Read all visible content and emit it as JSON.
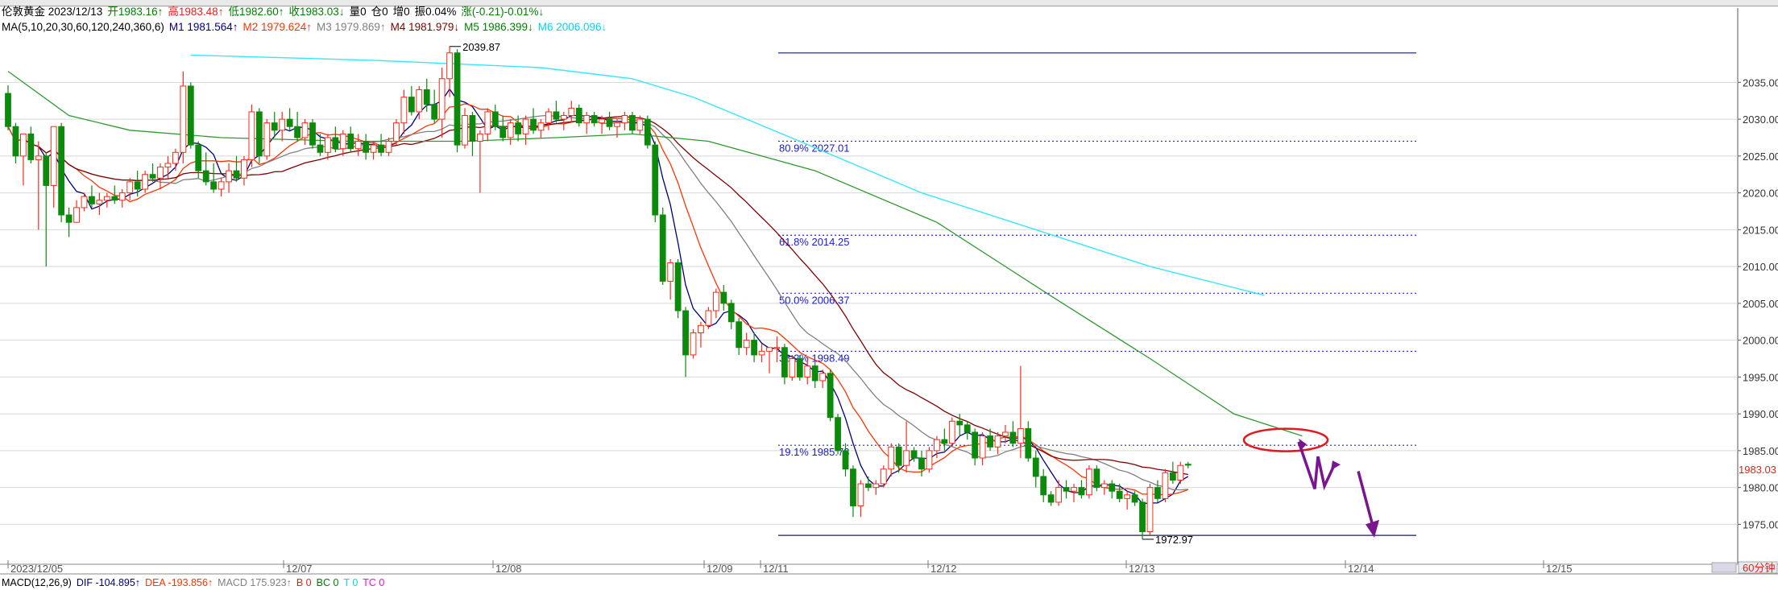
{
  "header": {
    "line1": [
      {
        "text": "伦敦黄金 2023/12/13",
        "color": "#000000"
      },
      {
        "text": "开1983.16↑",
        "color": "#008000"
      },
      {
        "text": "高1983.48↑",
        "color": "#e0241b"
      },
      {
        "text": "低1982.60↑",
        "color": "#008000"
      },
      {
        "text": "收1983.03↓",
        "color": "#008000"
      },
      {
        "text": "量0",
        "color": "#000000"
      },
      {
        "text": "仓0",
        "color": "#000000"
      },
      {
        "text": "增0",
        "color": "#000000"
      },
      {
        "text": "振0.04%",
        "color": "#000000"
      },
      {
        "text": "涨(-0.21)-0.01%↓",
        "color": "#008000"
      }
    ],
    "line2": [
      {
        "text": "MA(5,10,20,30,60,120,240,360,6)",
        "color": "#000000"
      },
      {
        "text": "M1 1981.564↑",
        "color": "#00007f"
      },
      {
        "text": "M2 1979.624↑",
        "color": "#ff3300"
      },
      {
        "text": "M3 1979.869↑",
        "color": "#808080"
      },
      {
        "text": "M4 1981.979↓",
        "color": "#7f0000"
      },
      {
        "text": "M5 1986.399↓",
        "color": "#008000"
      },
      {
        "text": "M6 2006.096↓",
        "color": "#00d8f0"
      }
    ]
  },
  "macd_header": [
    {
      "text": "MACD(12,26,9)",
      "color": "#000000"
    },
    {
      "text": "DIF -104.895↑",
      "color": "#00007f"
    },
    {
      "text": "DEA -193.856↑",
      "color": "#ff3300"
    },
    {
      "text": "MACD 175.923↑",
      "color": "#808080"
    },
    {
      "text": "B 0",
      "color": "#e0241b"
    },
    {
      "text": "BC 0",
      "color": "#008000"
    },
    {
      "text": "T 0",
      "color": "#00d8f0"
    },
    {
      "text": "TC 0",
      "color": "#ff00ff"
    }
  ],
  "chart_data": {
    "type": "candlestick",
    "instrument": "伦敦黄金",
    "timeframe_label": "60分钟",
    "last_price_label": "1983.03",
    "y_ticks": [
      "2035.00",
      "2030.00",
      "2025.00",
      "2020.00",
      "2015.00",
      "2010.00",
      "2005.00",
      "2000.00",
      "1995.00",
      "1990.00",
      "1985.00",
      "1980.00",
      "1975.00"
    ],
    "x_ticks": [
      "2023/12/05",
      "12/07",
      "12/08",
      "12/09",
      "12/11",
      "12/12",
      "12/13",
      "12/14",
      "12/15"
    ],
    "ylim": [
      1971.0,
      2040.5
    ],
    "grid": true,
    "candles": [
      [
        2033.5,
        2034.6,
        2028.5,
        2029.0
      ],
      [
        2029.0,
        2029.5,
        2024.0,
        2025.0
      ],
      [
        2025.0,
        2028.0,
        2021.0,
        2028.0
      ],
      [
        2028.0,
        2029.0,
        2024.0,
        2024.5
      ],
      [
        2024.5,
        2027.0,
        2015.0,
        2025.0
      ],
      [
        2025.0,
        2025.5,
        2010.0,
        2021.0
      ],
      [
        2021.0,
        2029.0,
        2018.0,
        2029.0
      ],
      [
        2029.0,
        2029.5,
        2016.0,
        2017.0
      ],
      [
        2017.0,
        2018.0,
        2014.0,
        2016.0
      ],
      [
        2016.0,
        2019.0,
        2016.0,
        2018.0
      ],
      [
        2018.0,
        2020.0,
        2017.5,
        2019.5
      ],
      [
        2019.5,
        2021.0,
        2018.0,
        2018.5
      ],
      [
        2018.5,
        2020.0,
        2017.0,
        2019.0
      ],
      [
        2019.0,
        2020.0,
        2018.0,
        2019.5
      ],
      [
        2019.5,
        2021.0,
        2018.5,
        2019.0
      ],
      [
        2019.0,
        2020.5,
        2018.0,
        2020.0
      ],
      [
        2020.0,
        2022.0,
        2019.0,
        2021.5
      ],
      [
        2021.5,
        2023.0,
        2019.5,
        2020.5
      ],
      [
        2020.5,
        2023.0,
        2020.0,
        2022.5
      ],
      [
        2022.5,
        2024.0,
        2021.5,
        2022.0
      ],
      [
        2022.0,
        2024.0,
        2020.5,
        2023.5
      ],
      [
        2023.5,
        2025.0,
        2022.0,
        2024.0
      ],
      [
        2024.0,
        2026.0,
        2023.0,
        2025.5
      ],
      [
        2025.5,
        2036.5,
        2024.0,
        2034.5
      ],
      [
        2034.5,
        2035.0,
        2026.0,
        2026.5
      ],
      [
        2026.5,
        2027.0,
        2022.0,
        2023.0
      ],
      [
        2023.0,
        2025.5,
        2021.0,
        2021.5
      ],
      [
        2021.5,
        2024.0,
        2020.0,
        2020.5
      ],
      [
        2020.5,
        2022.0,
        2019.5,
        2021.5
      ],
      [
        2021.5,
        2024.0,
        2020.0,
        2023.0
      ],
      [
        2023.0,
        2025.0,
        2021.5,
        2022.0
      ],
      [
        2022.0,
        2025.0,
        2021.0,
        2024.5
      ],
      [
        2024.5,
        2032.0,
        2023.5,
        2031.0
      ],
      [
        2031.0,
        2031.5,
        2024.0,
        2025.0
      ],
      [
        2025.0,
        2030.0,
        2024.5,
        2029.5
      ],
      [
        2029.5,
        2031.0,
        2027.5,
        2028.5
      ],
      [
        2028.5,
        2031.0,
        2027.0,
        2030.0
      ],
      [
        2030.0,
        2031.5,
        2028.5,
        2029.0
      ],
      [
        2029.0,
        2031.0,
        2027.0,
        2027.5
      ],
      [
        2027.5,
        2030.0,
        2026.5,
        2029.5
      ],
      [
        2029.5,
        2030.0,
        2026.0,
        2026.5
      ],
      [
        2026.5,
        2028.0,
        2025.0,
        2025.5
      ],
      [
        2025.5,
        2028.0,
        2024.5,
        2027.5
      ],
      [
        2027.5,
        2029.0,
        2025.5,
        2026.0
      ],
      [
        2026.0,
        2028.5,
        2025.0,
        2028.0
      ],
      [
        2028.0,
        2029.0,
        2025.5,
        2026.0
      ],
      [
        2026.0,
        2028.0,
        2025.0,
        2027.0
      ],
      [
        2027.0,
        2028.0,
        2024.5,
        2025.5
      ],
      [
        2025.5,
        2027.0,
        2024.5,
        2026.5
      ],
      [
        2026.5,
        2028.0,
        2025.0,
        2025.5
      ],
      [
        2025.5,
        2027.5,
        2025.0,
        2027.0
      ],
      [
        2027.0,
        2030.0,
        2026.5,
        2029.5
      ],
      [
        2029.5,
        2034.0,
        2028.0,
        2033.0
      ],
      [
        2033.0,
        2034.5,
        2030.5,
        2031.0
      ],
      [
        2031.0,
        2034.5,
        2030.0,
        2034.0
      ],
      [
        2034.0,
        2035.5,
        2031.0,
        2032.0
      ],
      [
        2032.0,
        2034.0,
        2029.5,
        2030.0
      ],
      [
        2030.0,
        2037.0,
        2027.5,
        2035.5
      ],
      [
        2035.5,
        2039.9,
        2033.0,
        2039.0
      ],
      [
        2039.0,
        2039.5,
        2025.5,
        2026.5
      ],
      [
        2026.5,
        2031.5,
        2026.0,
        2030.5
      ],
      [
        2030.5,
        2031.0,
        2025.0,
        2027.0
      ],
      [
        2027.0,
        2028.5,
        2020.0,
        2028.0
      ],
      [
        2028.0,
        2031.5,
        2027.0,
        2031.0
      ],
      [
        2031.0,
        2032.0,
        2028.5,
        2029.0
      ],
      [
        2029.0,
        2030.5,
        2027.0,
        2027.5
      ],
      [
        2027.5,
        2030.0,
        2026.5,
        2029.5
      ],
      [
        2029.5,
        2030.5,
        2027.0,
        2028.0
      ],
      [
        2028.0,
        2030.5,
        2026.5,
        2030.0
      ],
      [
        2030.0,
        2031.5,
        2028.0,
        2028.5
      ],
      [
        2028.5,
        2030.0,
        2027.5,
        2029.5
      ],
      [
        2029.5,
        2031.5,
        2028.5,
        2031.0
      ],
      [
        2031.0,
        2032.5,
        2029.5,
        2030.0
      ],
      [
        2030.0,
        2031.0,
        2028.5,
        2030.5
      ],
      [
        2030.5,
        2032.5,
        2029.5,
        2031.5
      ],
      [
        2031.5,
        2032.0,
        2029.0,
        2029.5
      ],
      [
        2029.5,
        2031.0,
        2028.0,
        2030.5
      ],
      [
        2030.5,
        2031.0,
        2029.0,
        2029.5
      ],
      [
        2029.5,
        2030.5,
        2028.0,
        2030.0
      ],
      [
        2030.0,
        2031.0,
        2028.5,
        2029.0
      ],
      [
        2029.0,
        2030.0,
        2027.5,
        2029.5
      ],
      [
        2029.5,
        2031.0,
        2028.5,
        2030.5
      ],
      [
        2030.5,
        2031.0,
        2028.0,
        2028.5
      ],
      [
        2028.5,
        2030.5,
        2028.0,
        2030.0
      ],
      [
        2030.0,
        2030.5,
        2026.0,
        2026.5
      ],
      [
        2026.5,
        2027.0,
        2016.0,
        2017.0
      ],
      [
        2017.0,
        2018.0,
        2007.5,
        2008.0
      ],
      [
        2008.0,
        2011.0,
        2005.5,
        2010.5
      ],
      [
        2010.5,
        2011.0,
        2003.0,
        2004.0
      ],
      [
        2004.0,
        2004.5,
        1995.0,
        1998.0
      ],
      [
        1998.0,
        2001.5,
        1997.5,
        2001.0
      ],
      [
        2001.0,
        2002.5,
        1999.0,
        2002.0
      ],
      [
        2002.0,
        2004.5,
        2001.5,
        2004.0
      ],
      [
        2004.0,
        2007.0,
        2003.0,
        2006.5
      ],
      [
        2006.5,
        2007.5,
        2004.0,
        2005.0
      ],
      [
        2005.0,
        2005.5,
        2001.5,
        2002.5
      ],
      [
        2002.5,
        2003.0,
        1998.0,
        1999.0
      ],
      [
        1999.0,
        2001.0,
        1998.0,
        2000.0
      ],
      [
        2000.0,
        2001.0,
        1997.0,
        1998.0
      ],
      [
        1998.0,
        1999.5,
        1997.0,
        1998.5
      ],
      [
        1998.5,
        1999.0,
        1995.5,
        1999.0
      ],
      [
        1999.0,
        2000.5,
        1997.0,
        1999.0
      ],
      [
        1999.0,
        1999.5,
        1994.0,
        1995.0
      ],
      [
        1995.0,
        1998.0,
        1994.5,
        1997.5
      ],
      [
        1997.5,
        1998.0,
        1994.5,
        1995.0
      ],
      [
        1995.0,
        1997.5,
        1994.0,
        1996.5
      ],
      [
        1996.5,
        1997.0,
        1993.5,
        1994.5
      ],
      [
        1994.5,
        1996.0,
        1993.5,
        1995.5
      ],
      [
        1995.5,
        1996.0,
        1989.0,
        1989.5
      ],
      [
        1989.5,
        1990.0,
        1984.5,
        1985.0
      ],
      [
        1985.0,
        1986.0,
        1981.5,
        1982.5
      ],
      [
        1982.5,
        1983.0,
        1976.0,
        1977.5
      ],
      [
        1977.5,
        1981.0,
        1976.0,
        1980.5
      ],
      [
        1980.5,
        1981.5,
        1979.5,
        1980.0
      ],
      [
        1980.0,
        1981.0,
        1979.0,
        1980.5
      ],
      [
        1980.5,
        1983.0,
        1980.0,
        1982.5
      ],
      [
        1982.5,
        1986.0,
        1981.5,
        1985.5
      ],
      [
        1985.5,
        1986.0,
        1982.0,
        1983.0
      ],
      [
        1983.0,
        1989.0,
        1982.0,
        1985.0
      ],
      [
        1985.0,
        1985.5,
        1983.5,
        1984.0
      ],
      [
        1984.0,
        1985.0,
        1981.5,
        1982.5
      ],
      [
        1982.5,
        1985.5,
        1982.0,
        1985.0
      ],
      [
        1985.0,
        1987.0,
        1984.0,
        1986.5
      ],
      [
        1986.5,
        1988.0,
        1985.0,
        1986.0
      ],
      [
        1986.0,
        1989.5,
        1985.5,
        1989.0
      ],
      [
        1989.0,
        1990.0,
        1987.0,
        1988.5
      ],
      [
        1988.5,
        1989.0,
        1986.5,
        1987.5
      ],
      [
        1987.5,
        1988.0,
        1983.0,
        1984.0
      ],
      [
        1984.0,
        1987.5,
        1983.0,
        1987.0
      ],
      [
        1987.0,
        1988.0,
        1985.0,
        1985.5
      ],
      [
        1985.5,
        1987.5,
        1984.5,
        1987.0
      ],
      [
        1987.0,
        1988.5,
        1986.0,
        1987.5
      ],
      [
        1987.5,
        1989.0,
        1985.5,
        1986.0
      ],
      [
        1986.0,
        1996.5,
        1984.0,
        1988.0
      ],
      [
        1988.0,
        1989.0,
        1983.5,
        1984.0
      ],
      [
        1984.0,
        1985.0,
        1980.0,
        1981.5
      ],
      [
        1981.5,
        1982.5,
        1978.0,
        1979.0
      ],
      [
        1979.0,
        1979.5,
        1977.5,
        1978.0
      ],
      [
        1978.0,
        1981.0,
        1977.5,
        1980.0
      ],
      [
        1980.0,
        1981.0,
        1978.5,
        1979.5
      ],
      [
        1979.5,
        1980.5,
        1978.0,
        1980.0
      ],
      [
        1980.0,
        1981.0,
        1978.5,
        1979.0
      ],
      [
        1979.0,
        1983.0,
        1978.5,
        1982.5
      ],
      [
        1982.5,
        1983.0,
        1979.5,
        1980.0
      ],
      [
        1980.0,
        1981.0,
        1979.0,
        1980.5
      ],
      [
        1980.5,
        1981.0,
        1978.5,
        1979.5
      ],
      [
        1979.5,
        1980.5,
        1978.0,
        1978.5
      ],
      [
        1978.5,
        1979.5,
        1977.0,
        1979.0
      ],
      [
        1979.0,
        1979.5,
        1977.5,
        1978.0
      ],
      [
        1978.0,
        1978.5,
        1972.97,
        1974.0
      ],
      [
        1974.0,
        1980.5,
        1973.5,
        1980.0
      ],
      [
        1980.0,
        1981.0,
        1978.0,
        1978.5
      ],
      [
        1978.5,
        1982.5,
        1978.0,
        1982.0
      ],
      [
        1982.0,
        1983.5,
        1980.5,
        1981.0
      ],
      [
        1981.0,
        1983.5,
        1980.5,
        1983.0
      ],
      [
        1983.16,
        1983.48,
        1982.6,
        1983.03
      ]
    ],
    "high_label": "2039.87",
    "low_label": "1972.97",
    "fibonacci_levels": [
      {
        "label": "80.9% 2027.01",
        "price": 2027.01
      },
      {
        "label": "61.8% 2014.25",
        "price": 2014.25
      },
      {
        "label": "50.0% 2006.37",
        "price": 2006.37
      },
      {
        "label": "38.2% 1998.49",
        "price": 1998.49
      },
      {
        "label": "19.1% 1985.73",
        "price": 1985.73
      }
    ],
    "fib_top_price": 2039.0,
    "fib_bottom_price": 1973.5,
    "ma_lines": [
      {
        "name": "M1",
        "color": "#00007f",
        "period": 5
      },
      {
        "name": "M2",
        "color": "#ff3300",
        "period": 10
      },
      {
        "name": "M3",
        "color": "#808080",
        "period": 20
      },
      {
        "name": "M4",
        "color": "#7f0000",
        "period": 30
      },
      {
        "name": "M5",
        "color": "#008000",
        "period": 60
      },
      {
        "name": "M6",
        "color": "#00e5ff",
        "period": 120
      }
    ],
    "m5_points": [
      [
        2036.5,
        0
      ],
      [
        2030.5,
        8
      ],
      [
        2028.5,
        16
      ],
      [
        2027.5,
        28
      ],
      [
        2027.0,
        45
      ],
      [
        2027.0,
        60
      ],
      [
        2027.5,
        72
      ],
      [
        2028.0,
        82
      ],
      [
        2027.0,
        92
      ],
      [
        2023.0,
        106
      ],
      [
        2016.0,
        122
      ],
      [
        2006.0,
        137
      ],
      [
        1997.5,
        150
      ],
      [
        1990.0,
        161
      ],
      [
        1987.0,
        170
      ]
    ],
    "m6_points": [
      [
        2038.7,
        24
      ],
      [
        2038.0,
        48
      ],
      [
        2037.0,
        70
      ],
      [
        2035.5,
        82
      ],
      [
        2033.0,
        90
      ],
      [
        2027.0,
        104
      ],
      [
        2020.0,
        120
      ],
      [
        2015.0,
        135
      ],
      [
        2010.0,
        150
      ],
      [
        2006.1,
        165
      ]
    ],
    "colors": {
      "up": "#ff2a1a",
      "down": "#0c8a0c",
      "fib_line": "#2222ee",
      "fib_text": "#1a1ad0",
      "grid": "#d8d8d8",
      "annotation": "#e2191e",
      "arrow": "#7a1590"
    }
  }
}
